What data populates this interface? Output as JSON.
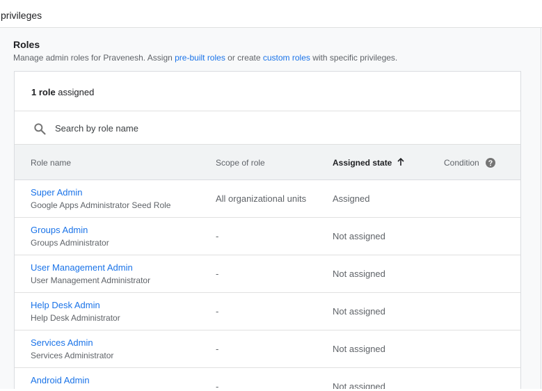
{
  "header": {
    "title": "privileges"
  },
  "roles_section": {
    "title": "Roles",
    "desc_prefix": "Manage admin roles for Pravenesh. Assign ",
    "prebuilt_link": "pre-built roles",
    "desc_middle": " or create ",
    "custom_link": "custom roles",
    "desc_suffix": " with specific privileges."
  },
  "card": {
    "count": "1 role",
    "count_suffix": " assigned",
    "search": {
      "placeholder": "Search by role name",
      "value": ""
    },
    "columns": {
      "role_name": "Role name",
      "scope": "Scope of role",
      "assigned_state": "Assigned state",
      "condition": "Condition"
    },
    "sort_icon": "arrow-upward-icon",
    "rows": [
      {
        "name": "Super Admin",
        "description": "Google Apps Administrator Seed Role",
        "scope": "All organizational units",
        "state": "Assigned"
      },
      {
        "name": "Groups Admin",
        "description": "Groups Administrator",
        "scope": "-",
        "state": "Not assigned"
      },
      {
        "name": "User Management Admin",
        "description": "User Management Administrator",
        "scope": "-",
        "state": "Not assigned"
      },
      {
        "name": "Help Desk Admin",
        "description": "Help Desk Administrator",
        "scope": "-",
        "state": "Not assigned"
      },
      {
        "name": "Services Admin",
        "description": "Services Administrator",
        "scope": "-",
        "state": "Not assigned"
      },
      {
        "name": "Android Admin",
        "description": "",
        "scope": "-",
        "state": "Not assigned"
      }
    ]
  },
  "colors": {
    "link": "#1a73e8",
    "text": "#202124",
    "secondary_text": "#5f6368",
    "panel_bg": "#f8f9fa",
    "header_bg": "#f1f3f4"
  }
}
